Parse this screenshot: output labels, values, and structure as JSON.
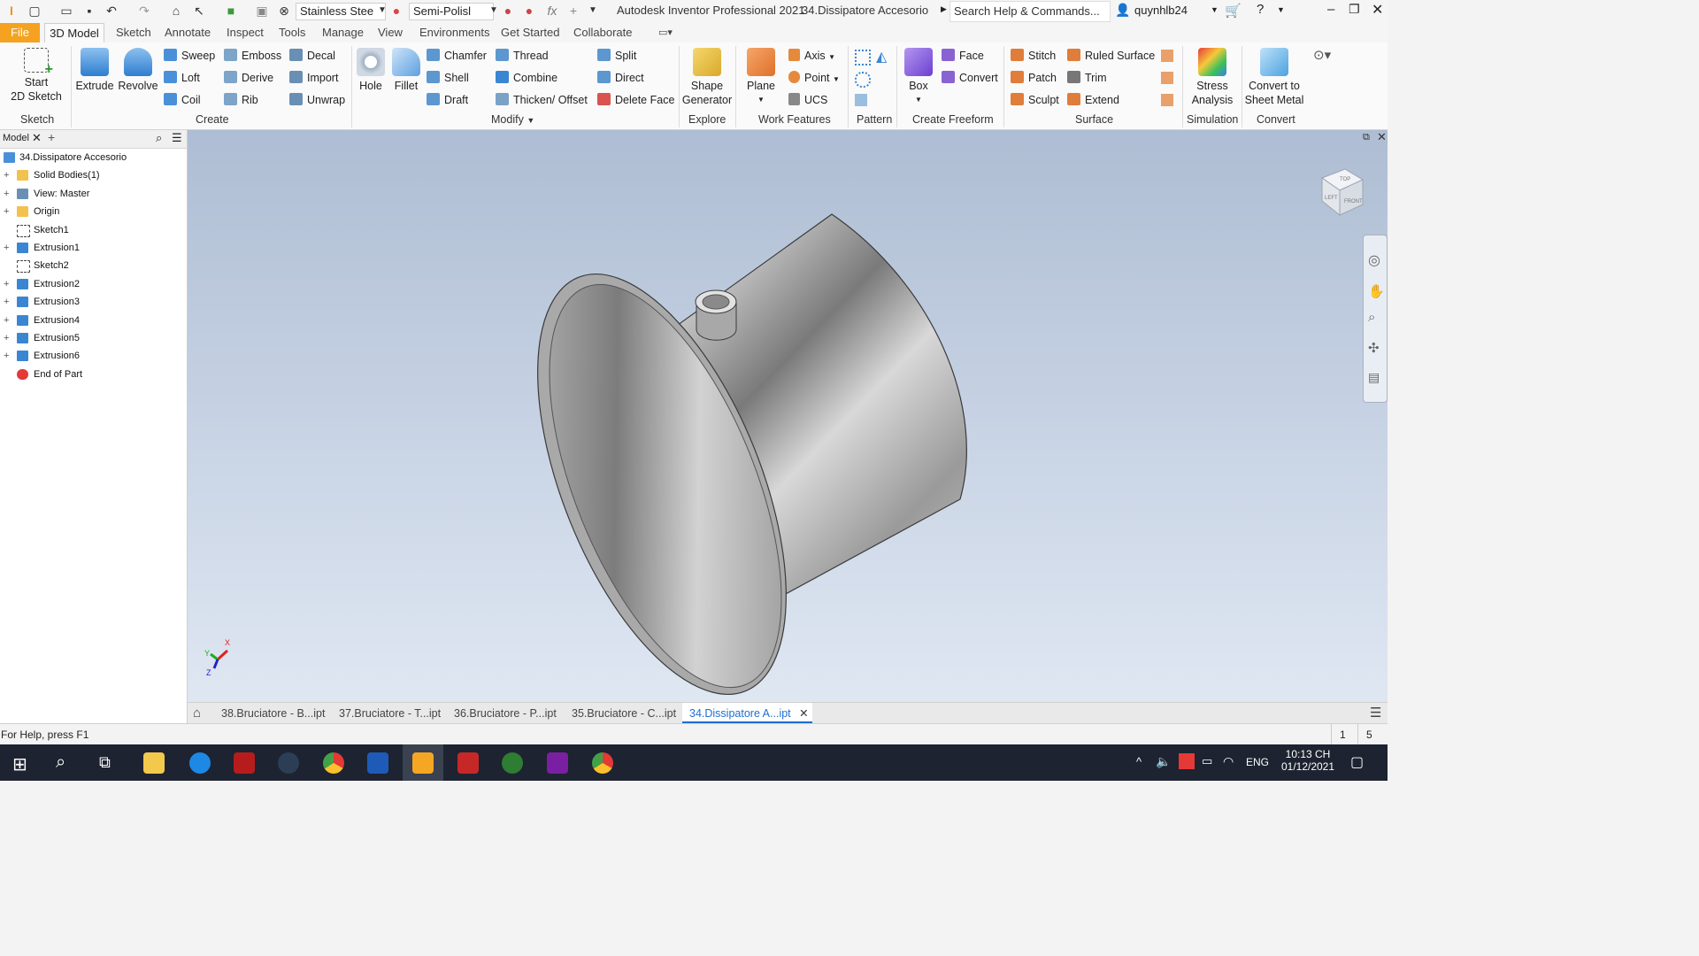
{
  "titlebar": {
    "material": "Stainless Stee",
    "appearance": "Semi-Polisl",
    "app_title": "Autodesk Inventor Professional 2021",
    "doc_title": "34.Dissipatore Accesorio",
    "search_placeholder": "Search Help & Commands...",
    "user": "quynhlb24"
  },
  "menu_tabs": [
    "File",
    "3D Model",
    "Sketch",
    "Annotate",
    "Inspect",
    "Tools",
    "Manage",
    "View",
    "Environments",
    "Get Started",
    "Collaborate"
  ],
  "ribbon": {
    "start_sketch": [
      "Start",
      "2D Sketch"
    ],
    "extrude": "Extrude",
    "revolve": "Revolve",
    "create_small": [
      "Sweep",
      "Loft",
      "Coil",
      "Emboss",
      "Derive",
      "Rib",
      "Decal",
      "Import",
      "Unwrap"
    ],
    "hole": "Hole",
    "fillet": "Fillet",
    "modify_small": [
      "Chamfer",
      "Shell",
      "Draft",
      "Thread",
      "Combine",
      "Thicken/ Offset",
      "Split",
      "Direct",
      "Delete Face"
    ],
    "shape_generator": [
      "Shape",
      "Generator"
    ],
    "plane": "Plane",
    "work_small": [
      "Axis",
      "Point",
      "UCS"
    ],
    "box": "Box",
    "freeform_small": [
      "Face",
      "Convert"
    ],
    "surface_small": [
      "Stitch",
      "Patch",
      "Sculpt",
      "Ruled Surface",
      "Trim",
      "Extend"
    ],
    "stress": [
      "Stress",
      "Analysis"
    ],
    "convert_sheet": [
      "Convert to",
      "Sheet Metal"
    ],
    "panels": [
      "Sketch",
      "Create",
      "Modify",
      "Explore",
      "Work Features",
      "Pattern",
      "Create Freeform",
      "Surface",
      "Simulation",
      "Convert"
    ]
  },
  "browser": {
    "tab": "Model",
    "items": [
      {
        "label": "34.Dissipatore Accesorio",
        "icon": "part-icon",
        "expand": ""
      },
      {
        "label": "Solid Bodies(1)",
        "icon": "folder-icon",
        "expand": "+"
      },
      {
        "label": "View: Master",
        "icon": "view-icon",
        "expand": "+"
      },
      {
        "label": "Origin",
        "icon": "folder-icon",
        "expand": "+"
      },
      {
        "label": "Sketch1",
        "icon": "sketch-icon",
        "expand": ""
      },
      {
        "label": "Extrusion1",
        "icon": "extrusion-icon",
        "expand": "+"
      },
      {
        "label": "Sketch2",
        "icon": "sketch-icon",
        "expand": ""
      },
      {
        "label": "Extrusion2",
        "icon": "extrusion-icon",
        "expand": "+"
      },
      {
        "label": "Extrusion3",
        "icon": "extrusion-icon",
        "expand": "+"
      },
      {
        "label": "Extrusion4",
        "icon": "extrusion-icon",
        "expand": "+"
      },
      {
        "label": "Extrusion5",
        "icon": "extrusion-icon",
        "expand": "+"
      },
      {
        "label": "Extrusion6",
        "icon": "extrusion-icon",
        "expand": "+"
      },
      {
        "label": "End of Part",
        "icon": "end-of-part-icon",
        "expand": ""
      }
    ]
  },
  "viewcube": {
    "top": "TOP",
    "left": "LEFT",
    "front": "FRONT"
  },
  "triad": {
    "x": "X",
    "y": "Y",
    "z": "Z"
  },
  "doc_tabs": [
    "38.Bruciatore - B...ipt",
    "37.Bruciatore - T...ipt",
    "36.Bruciatore - P...ipt",
    "35.Bruciatore - C...ipt",
    "34.Dissipatore A...ipt"
  ],
  "status": {
    "help": "For Help, press F1",
    "count1": "1",
    "count2": "5"
  },
  "taskbar": {
    "lang": "ENG",
    "time": "10:13 CH",
    "date": "01/12/2021"
  },
  "colors": {
    "accent_file": "#f4a21f",
    "active_tab": "#1e6fcf",
    "viewport_top": "#aebdd3",
    "viewport_bottom": "#dfe7f2",
    "taskbar": "#1d2330"
  }
}
